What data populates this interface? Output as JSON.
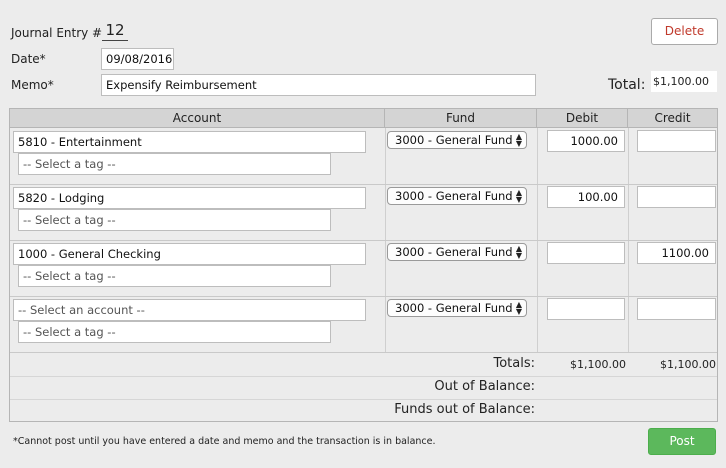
{
  "header": {
    "journal_entry_label": "Journal Entry #",
    "journal_entry_number": "12",
    "date_label": "Date*",
    "date_value": "09/08/2016",
    "memo_label": "Memo*",
    "memo_value": "Expensify Reimbursement",
    "total_label": "Total:",
    "total_value": "$1,100.00",
    "delete_label": "Delete"
  },
  "columns": {
    "account": "Account",
    "fund": "Fund",
    "debit": "Debit",
    "credit": "Credit"
  },
  "lines": [
    {
      "account": "5810 - Entertainment",
      "tag": "-- Select a tag --",
      "fund": "3000 - General Fund",
      "debit": "1000.00",
      "credit": ""
    },
    {
      "account": "5820 - Lodging",
      "tag": "-- Select a tag --",
      "fund": "3000 - General Fund",
      "debit": "100.00",
      "credit": ""
    },
    {
      "account": "1000 - General Checking",
      "tag": "-- Select a tag --",
      "fund": "3000 - General Fund",
      "debit": "",
      "credit": "1100.00"
    },
    {
      "account": "-- Select an account --",
      "tag": "-- Select a tag --",
      "fund": "3000 - General Fund",
      "debit": "",
      "credit": ""
    }
  ],
  "totals": {
    "totals_label": "Totals:",
    "debit_total": "$1,100.00",
    "credit_total": "$1,100.00",
    "out_of_balance_label": "Out of Balance:",
    "funds_out_of_balance_label": "Funds out of Balance:"
  },
  "footer": {
    "note": "*Cannot post until you have entered a date and memo and the transaction is in balance.",
    "post_label": "Post"
  },
  "colors": {
    "post_button": "#5cb85c",
    "delete_text": "#c0392b",
    "header_bg": "#d4d4d4",
    "page_bg": "#ececec"
  }
}
